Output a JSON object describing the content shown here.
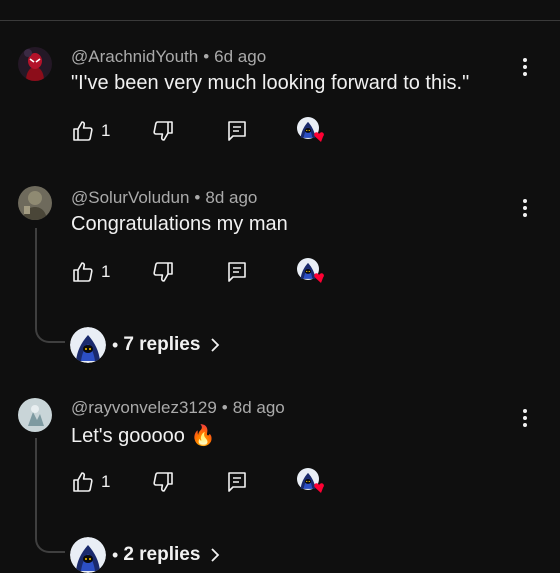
{
  "comments": [
    {
      "author": "@ArachnidYouth",
      "time": "6d ago",
      "text": "\"I've been very much looking forward to this.\"",
      "likes": "1",
      "avatar": "spiderman-avatar"
    },
    {
      "author": "@SolurVoludun",
      "time": "8d ago",
      "text": "Congratulations my man",
      "likes": "1",
      "avatar": "photo-avatar",
      "replies_label": "7 replies"
    },
    {
      "author": "@rayvonvelez3129",
      "time": "8d ago",
      "text": "Let's gooooo 🔥",
      "likes": "1",
      "avatar": "light-photo-avatar",
      "replies_label": "2 replies"
    }
  ],
  "separator": "•",
  "icons": {
    "like": "thumbs-up-icon",
    "dislike": "thumbs-down-icon",
    "reply": "reply-icon",
    "more": "more-vertical-icon",
    "heart": "creator-heart-icon",
    "chevron": "chevron-right-icon"
  },
  "colors": {
    "heart": "#ff0033",
    "meta": "#aaaaaa",
    "background": "#0f0f0f"
  }
}
